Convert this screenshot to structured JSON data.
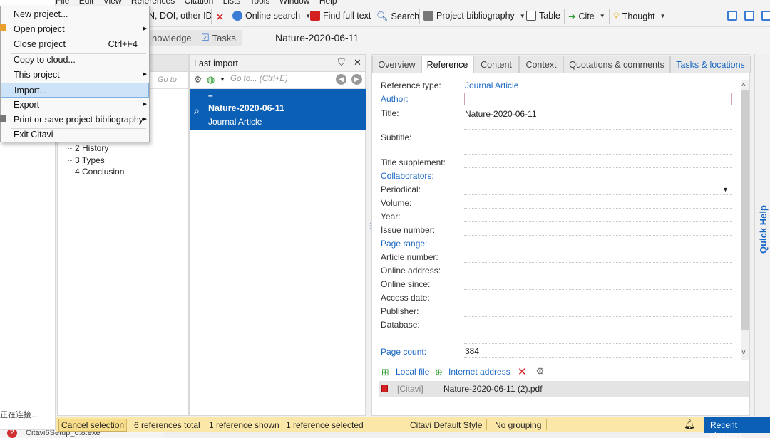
{
  "menubar": [
    "File",
    "Edit",
    "View",
    "References",
    "Citation",
    "Lists",
    "Tools",
    "Window",
    "Help"
  ],
  "toolbar": {
    "add_by_id": "N, DOI, other ID",
    "online_search": "Online search",
    "find_full_text": "Find full text",
    "search": "Search",
    "project_bibliography": "Project bibliography",
    "table": "Table",
    "cite": "Cite",
    "thought": "Thought"
  },
  "nav": {
    "knowledge": "nowledge",
    "tasks": "Tasks",
    "project_title": "Nature-2020-06-11"
  },
  "file_menu": {
    "items": [
      {
        "label": "New project...",
        "shortcut": "",
        "submenu": false
      },
      {
        "label": "Open project",
        "shortcut": "",
        "submenu": true
      },
      {
        "label": "Close project",
        "shortcut": "Ctrl+F4",
        "submenu": false
      },
      {
        "label": "Copy to cloud...",
        "shortcut": "",
        "submenu": false
      },
      {
        "label": "This project",
        "shortcut": "",
        "submenu": true
      },
      {
        "label": "Import...",
        "shortcut": "",
        "submenu": false
      },
      {
        "label": "Export",
        "shortcut": "",
        "submenu": true
      },
      {
        "label": "Print or save project bibliography",
        "shortcut": "",
        "submenu": true
      },
      {
        "label": "Exit Citavi",
        "shortcut": "",
        "submenu": false
      }
    ],
    "highlighted_index": 5
  },
  "categories": {
    "goto_placeholder": "Go to",
    "tree": [
      "2 History",
      "3 Types",
      "4 Conclusion"
    ]
  },
  "list": {
    "header": "Last import",
    "goto_placeholder": "Go to... (Ctrl+E)",
    "selected": {
      "marker": "–",
      "title": "Nature-2020-06-11",
      "type": "Journal Article"
    }
  },
  "detail": {
    "tabs": [
      "Overview",
      "Reference",
      "Content",
      "Context",
      "Quotations & comments",
      "Tasks & locations"
    ],
    "active_tab": "Reference",
    "fields": {
      "reference_type_label": "Reference type:",
      "reference_type_value": "Journal Article",
      "author": "Author:",
      "title": "Title:",
      "title_value": "Nature-2020-06-11",
      "subtitle": "Subtitle:",
      "title_supplement": "Title supplement:",
      "collaborators": "Collaborators:",
      "periodical": "Periodical:",
      "volume": "Volume:",
      "year": "Year:",
      "issue_number": "Issue number:",
      "page_range": "Page range:",
      "article_number": "Article number:",
      "online_address": "Online address:",
      "online_since": "Online since:",
      "access_date": "Access date:",
      "publisher": "Publisher:",
      "database": "Database:",
      "page_count": "Page count:",
      "page_count_value": "384"
    },
    "attachments": {
      "local_file": "Local file",
      "internet_address": "Internet address",
      "row_source": "[Citavi]",
      "row_file": "Nature-2020-06-11 (2).pdf"
    }
  },
  "quick_help": "Quick Help",
  "status": {
    "cancel_selection": "Cancel selection",
    "refs_total": "6 references total",
    "refs_shown": "1 reference shown",
    "refs_selected": "1 reference selected",
    "style": "Citavi Default Style",
    "grouping": "No grouping",
    "recent_changes": "Recent changes"
  },
  "desktop": {
    "connecting": "正在连接...",
    "taskbar_item": "Citavi6Setup_6.8.exe"
  },
  "colors": {
    "accent_blue": "#0b5fb4",
    "link_blue": "#1a68c4",
    "status_yellow": "#fbe8a8",
    "menu_highlight": "#cde3f8"
  }
}
